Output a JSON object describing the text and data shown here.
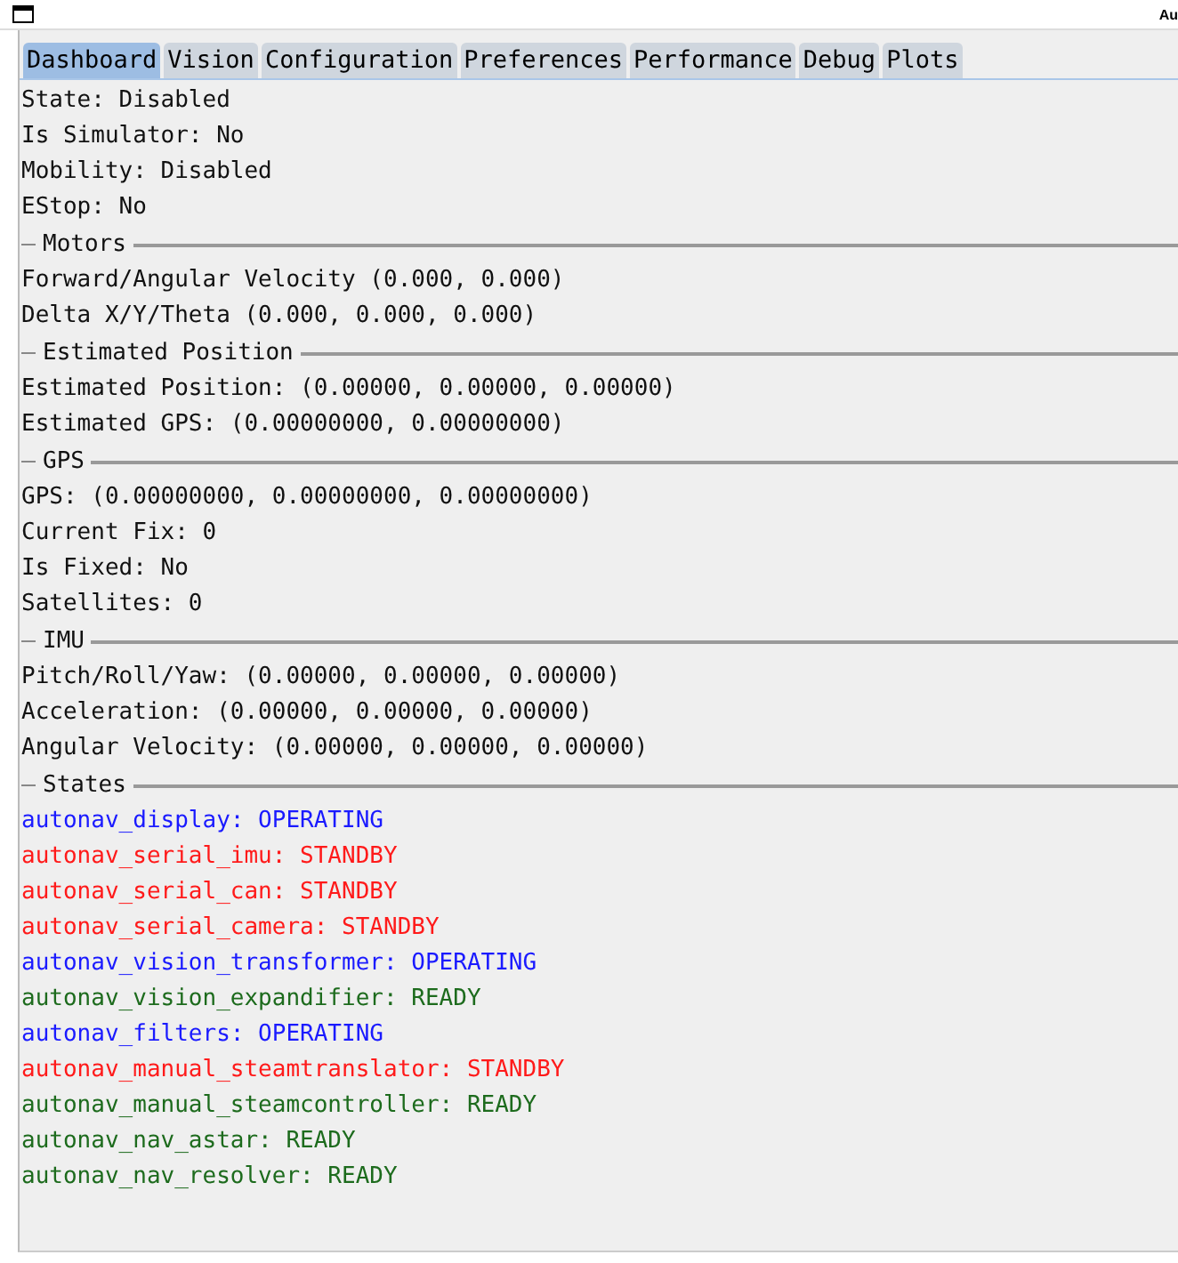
{
  "window": {
    "title": "Au"
  },
  "tabs": [
    {
      "label": "Dashboard",
      "selected": true
    },
    {
      "label": "Vision",
      "selected": false
    },
    {
      "label": "Configuration",
      "selected": false
    },
    {
      "label": "Preferences",
      "selected": false
    },
    {
      "label": "Performance",
      "selected": false
    },
    {
      "label": "Debug",
      "selected": false
    },
    {
      "label": "Plots",
      "selected": false
    }
  ],
  "status_lines": [
    "State: Disabled",
    "Is Simulator: No",
    "Mobility: Disabled",
    "EStop: No"
  ],
  "sections": [
    {
      "title": "Motors",
      "lines": [
        "Forward/Angular Velocity (0.000, 0.000)",
        "Delta X/Y/Theta (0.000, 0.000, 0.000)"
      ]
    },
    {
      "title": "Estimated Position",
      "lines": [
        "Estimated Position: (0.00000, 0.00000, 0.00000)",
        "Estimated GPS: (0.00000000, 0.00000000)"
      ]
    },
    {
      "title": "GPS",
      "lines": [
        "GPS: (0.00000000, 0.00000000, 0.00000000)",
        "Current Fix: 0",
        "Is Fixed: No",
        "Satellites: 0"
      ]
    },
    {
      "title": "IMU",
      "lines": [
        "Pitch/Roll/Yaw: (0.00000, 0.00000, 0.00000)",
        "Acceleration: (0.00000, 0.00000, 0.00000)",
        "Angular Velocity: (0.00000, 0.00000, 0.00000)"
      ]
    }
  ],
  "states": {
    "title": "States",
    "items": [
      {
        "text": "autonav_display: OPERATING",
        "color": "#1a1aff"
      },
      {
        "text": "autonav_serial_imu: STANDBY",
        "color": "#ff1a1a"
      },
      {
        "text": "autonav_serial_can: STANDBY",
        "color": "#ff1a1a"
      },
      {
        "text": "autonav_serial_camera: STANDBY",
        "color": "#ff1a1a"
      },
      {
        "text": "autonav_vision_transformer: OPERATING",
        "color": "#1a1aff"
      },
      {
        "text": "autonav_vision_expandifier: READY",
        "color": "#1d6b1d"
      },
      {
        "text": "autonav_filters: OPERATING",
        "color": "#1a1aff"
      },
      {
        "text": "autonav_manual_steamtranslator: STANDBY",
        "color": "#ff1a1a"
      },
      {
        "text": "autonav_manual_steamcontroller: READY",
        "color": "#1d6b1d"
      },
      {
        "text": "autonav_nav_astar: READY",
        "color": "#1d6b1d"
      },
      {
        "text": "autonav_nav_resolver: READY",
        "color": "#1d6b1d"
      }
    ]
  }
}
